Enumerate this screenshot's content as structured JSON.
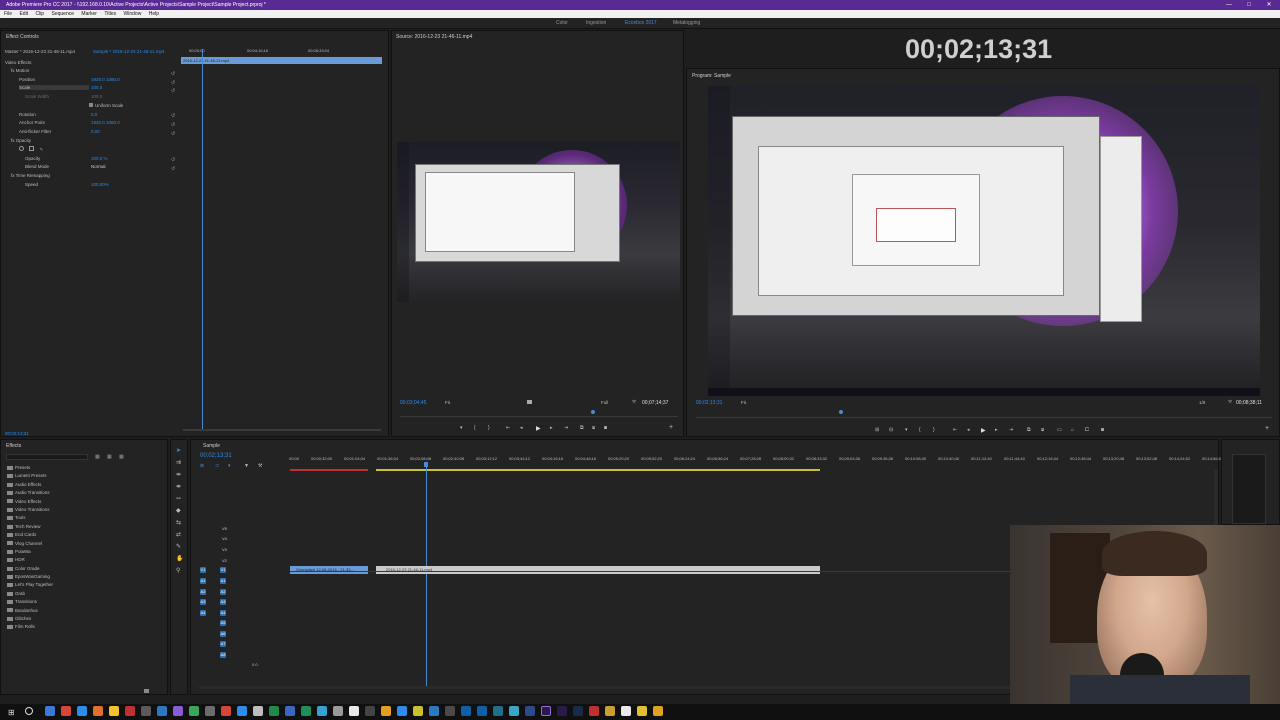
{
  "window": {
    "title": "Adobe Premiere Pro CC 2017 - \\\\192.168.0.10\\Active Projects\\Active Projects\\Sample Project\\Sample Project.prproj *",
    "controls": [
      "—",
      "□",
      "✕"
    ]
  },
  "menu": [
    "File",
    "Edit",
    "Clip",
    "Sequence",
    "Marker",
    "Titles",
    "Window",
    "Help"
  ],
  "workspaces": [
    "Color",
    "Ingestion",
    "Ecoxbox 2017",
    "Metalogging"
  ],
  "active_workspace": "Ecoxbox 2017",
  "effect_controls": {
    "tab": "Effect Controls",
    "master": "Master * 2016-12-23 21-46-11.mp4",
    "sequence": "Sample * 2016-12-23 21-46-11.mp4",
    "ruler": [
      "00;00;00",
      "00;04;16;16",
      "00;08;33;04"
    ],
    "clip_bar": "2016-12-23 21-46-11.mp4",
    "section": "Video Effects",
    "rows": [
      {
        "label": "Motion",
        "value": ""
      },
      {
        "label": "Position",
        "value": "1920.0   1080.0"
      },
      {
        "label": "Scale",
        "value": "100.0"
      },
      {
        "label": "Scale Width",
        "value": "100.0"
      },
      {
        "label": "Uniform Scale",
        "value": ""
      },
      {
        "label": "Rotation",
        "value": "0.0"
      },
      {
        "label": "Anchor Point",
        "value": "1920.0   1080.0"
      },
      {
        "label": "Anti-flicker Filter",
        "value": "0.00"
      },
      {
        "label": "Opacity",
        "value": ""
      },
      {
        "label": "Opacity",
        "value": "100.0 %"
      },
      {
        "label": "Blend Mode",
        "value": "Normal"
      },
      {
        "label": "Time Remapping",
        "value": ""
      },
      {
        "label": "Speed",
        "value": "100.00%"
      }
    ],
    "timecode": "00;02;13;31"
  },
  "source_monitor": {
    "title": "Source: 2016-12-23 21-46-11.mp4",
    "timecode": "00;03;04;45",
    "fit": "Fit",
    "resolution": "Full",
    "duration": "00;07;14;37"
  },
  "program_monitor": {
    "big_timecode": "00;02;13;31",
    "title": "Program: Sample",
    "timecode": "00;02;13;31",
    "fit": "Fit",
    "resolution": "1/8",
    "duration": "00;08;38;11"
  },
  "effects_panel": {
    "title": "Effects",
    "folders": [
      "Presets",
      "Lumetri Presets",
      "Audio Effects",
      "Audio Transitions",
      "Video Effects",
      "Video Transitions",
      "Tools",
      "Tech Review",
      "End Cards",
      "Vlog Channel",
      "PolaWa",
      "HDR",
      "Color Grade",
      "EposWasGaming",
      "Let's Play Together",
      "Grab",
      "Transitions",
      "Bandanhus",
      "Glitches",
      "Film Rolls"
    ]
  },
  "timeline": {
    "title": "Sample",
    "timecode": "00;02;13;31",
    "ruler": [
      "00;00",
      "00;00;32;00",
      "00;01;04;04",
      "00;01;36;04",
      "00;02;08;08",
      "00;02;40;08",
      "00;03;12;12",
      "00;03;44;12",
      "00;04;16;16",
      "00;04;48;16",
      "00;05;20;20",
      "00;05;52;20",
      "00;06;24;24",
      "00;06;56;24",
      "00;07;28;28",
      "00;08;00;32",
      "00;08;33;32",
      "00;09;04;36",
      "00;09;36;36",
      "00;10;08;40",
      "00;10;40;40",
      "00;11;12;40",
      "00;11;44;40",
      "00;12;16;44",
      "00;12;48;44",
      "00;13;20;48",
      "00;13;52;48",
      "00;14;24;52",
      "00;14;56;52"
    ],
    "video_tracks": [
      "V5",
      "V4",
      "V3",
      "V2",
      "V1"
    ],
    "audio_tracks": [
      "A1",
      "A2",
      "A3",
      "A4",
      "A5",
      "A6",
      "A7",
      "A8"
    ],
    "clips": [
      {
        "name": "Overwatch 12-08-2016 - 21-33-...",
        "color": "#6b9bd6"
      },
      {
        "name": "2016-12-23 21-46-11.mp4",
        "color": "#c9c9c9"
      }
    ],
    "zoom": "0.0"
  }
}
